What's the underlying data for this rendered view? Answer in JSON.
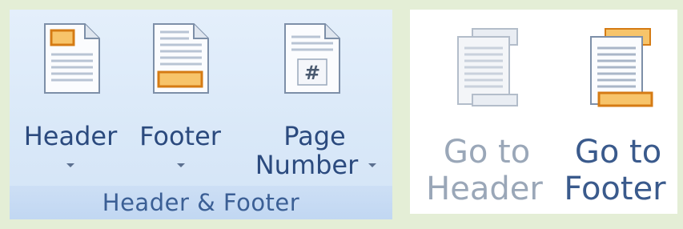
{
  "header_footer_group": {
    "title": "Header & Footer",
    "buttons": [
      {
        "label": "Header",
        "icon": "header-icon",
        "has_dropdown": true
      },
      {
        "label": "Footer",
        "icon": "footer-icon",
        "has_dropdown": true
      },
      {
        "label_line1": "Page",
        "label_line2": "Number",
        "icon": "page-number-icon",
        "has_dropdown": true,
        "icon_text": "#"
      }
    ]
  },
  "navigation_group": {
    "buttons": [
      {
        "label_line1": "Go to",
        "label_line2": "Header",
        "icon": "go-to-header-icon",
        "enabled": false
      },
      {
        "label_line1": "Go to",
        "label_line2": "Footer",
        "icon": "go-to-footer-icon",
        "enabled": true
      }
    ]
  },
  "colors": {
    "accent_orange": "#f0a030",
    "label_blue": "#2b4a7e",
    "disabled_gray": "#9aa7b8"
  }
}
